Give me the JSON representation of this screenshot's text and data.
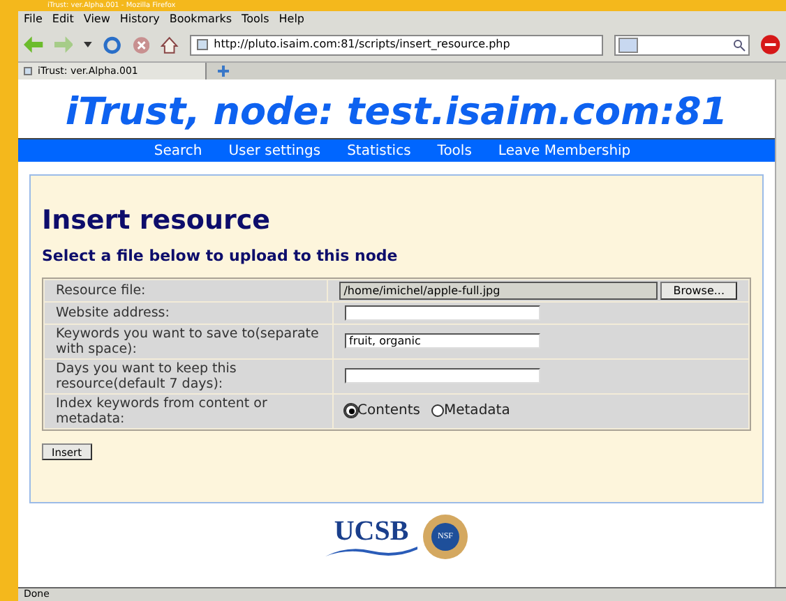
{
  "window": {
    "title": "iTrust: ver.Alpha.001 - Mozilla Firefox"
  },
  "menu": [
    "File",
    "Edit",
    "View",
    "History",
    "Bookmarks",
    "Tools",
    "Help"
  ],
  "address_bar": {
    "value": "http://pluto.isaim.com:81/scripts/insert_resource.php"
  },
  "tabs": [
    {
      "label": "iTrust: ver.Alpha.001",
      "selected": true
    }
  ],
  "page": {
    "banner": "iTrust, node: test.isaim.com:81",
    "nav": [
      "Search",
      "User settings",
      "Statistics",
      "Tools",
      "Leave Membership"
    ],
    "heading": "Insert resource",
    "subheading": "Select a file below to upload to this node",
    "rows": [
      {
        "label": "Resource file:",
        "kind": "file",
        "value": "/home/imichel/apple-full.jpg",
        "button": "Browse..."
      },
      {
        "label": "Website address:",
        "kind": "text"
      },
      {
        "label": "Keywords you want to save to(separate with space):",
        "kind": "text",
        "value": "fruit, organic"
      },
      {
        "label": "Days you want to keep this resource(default 7 days):",
        "kind": "text"
      },
      {
        "label": "Index keywords from content or metadata:",
        "kind": "radio",
        "options": [
          {
            "label": "Contents",
            "selected": true
          },
          {
            "label": "Metadata",
            "selected": false
          }
        ]
      }
    ],
    "submit": "Insert",
    "logo": {
      "text": "UCSB",
      "seal": "NSF"
    }
  },
  "status_bar": "Done"
}
